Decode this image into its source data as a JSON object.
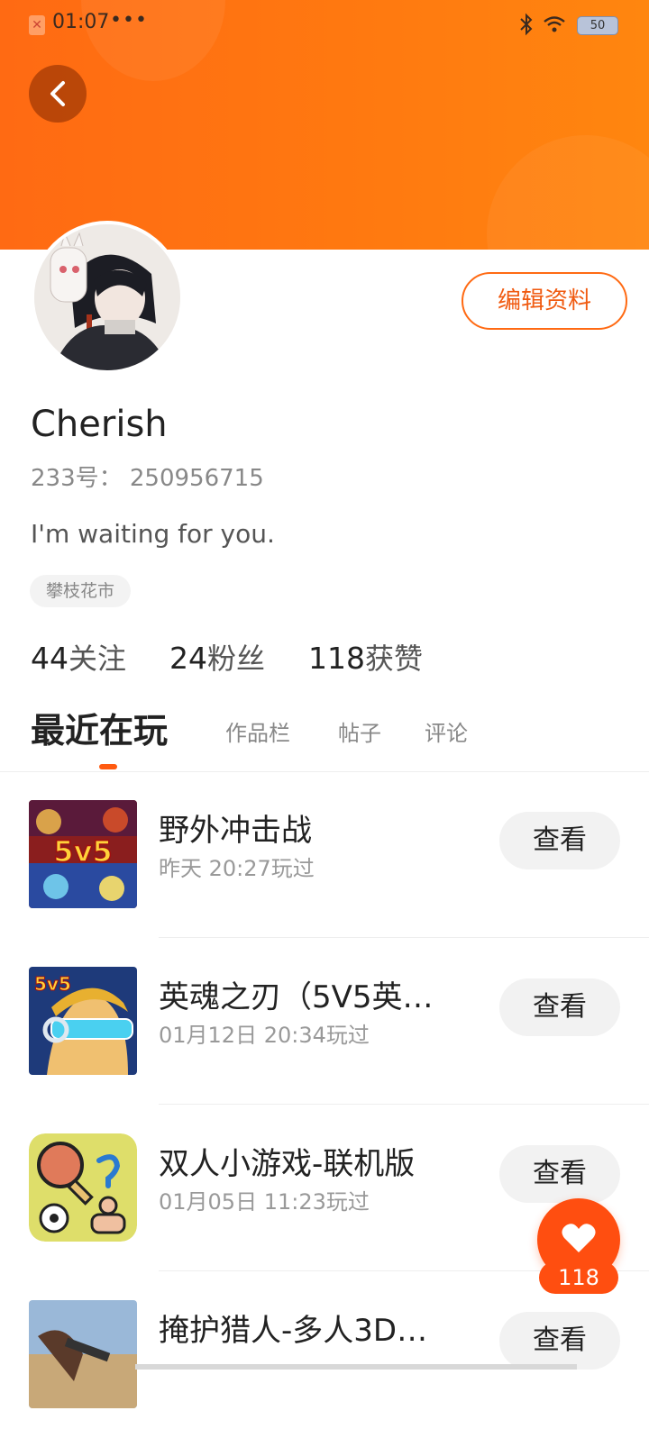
{
  "status_bar": {
    "time": "01:07",
    "dots": "•••",
    "battery": "50"
  },
  "profile": {
    "edit_label": "编辑资料",
    "username": "Cherish",
    "uid": "233号： 250956715",
    "bio": "I'm waiting for you.",
    "tag": "攀枝花市",
    "stats": [
      {
        "num": "44",
        "label": "关注"
      },
      {
        "num": "24",
        "label": "粉丝"
      },
      {
        "num": "118",
        "label": "获赞"
      }
    ]
  },
  "tabs": [
    {
      "label": "最近在玩"
    },
    {
      "label": "作品栏"
    },
    {
      "label": "帖子"
    },
    {
      "label": "评论"
    }
  ],
  "games": [
    {
      "title": "野外冲击战",
      "time": "昨天 20:27玩过",
      "button": "查看",
      "icon": "5v5-battle-icon"
    },
    {
      "title": "英魂之刃（5V5英…",
      "time": "01月12日 20:34玩过",
      "button": "查看",
      "icon": "hero-blade-icon"
    },
    {
      "title": "双人小游戏-联机版",
      "time": "01月05日 11:23玩过",
      "button": "查看",
      "icon": "two-player-icon"
    },
    {
      "title": "掩护猎人-多人3D…",
      "time": "",
      "button": "查看",
      "icon": "cover-hunter-icon"
    }
  ],
  "like_fab": {
    "count": "118"
  },
  "colors": {
    "accent": "#ff6a13",
    "like": "#ff4e10"
  }
}
